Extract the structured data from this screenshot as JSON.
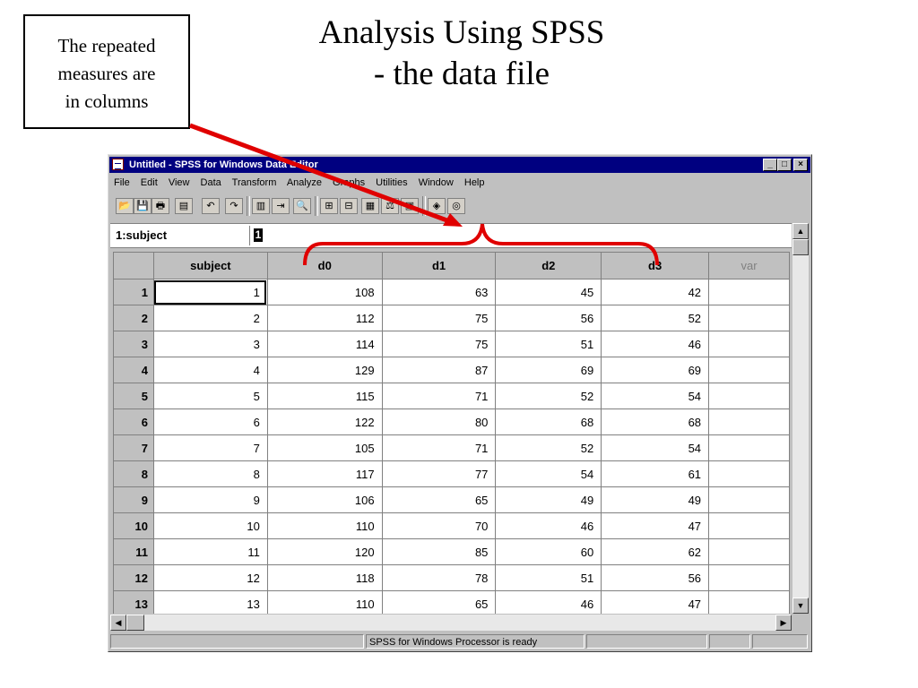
{
  "slide": {
    "title_line1": "Analysis Using SPSS",
    "title_line2": "- the data file",
    "callout": [
      "The repeated",
      "measures are",
      "in columns"
    ]
  },
  "window": {
    "title": "Untitled - SPSS for Windows Data Editor",
    "buttons": [
      "_",
      "□",
      "×"
    ]
  },
  "menu": [
    "File",
    "Edit",
    "View",
    "Data",
    "Transform",
    "Analyze",
    "Graphs",
    "Utilities",
    "Window",
    "Help"
  ],
  "toolbar": {
    "icons": [
      "open-icon",
      "save-icon",
      "print-icon",
      "dialog-recall-icon",
      "undo-icon",
      "redo-icon",
      "goto-chart-icon",
      "goto-case-icon",
      "variables-icon",
      "find-icon",
      "insert-case-icon",
      "insert-variable-icon",
      "split-file-icon",
      "weight-cases-icon",
      "select-cases-icon",
      "value-labels-icon",
      "use-sets-icon"
    ],
    "glyphs": [
      "📂",
      "💾",
      "🖶",
      "▤",
      "↶",
      "↷",
      "▥",
      "⇥",
      "?",
      "🔍",
      "⊞",
      "⊟",
      "▦",
      "⚖",
      "▣",
      "◈",
      "◎"
    ]
  },
  "cell_editor": {
    "reference": "1:subject",
    "value": "1"
  },
  "grid": {
    "columns": [
      "subject",
      "d0",
      "d1",
      "d2",
      "d3",
      "var"
    ],
    "rows": [
      [
        "1",
        "1",
        "108",
        "63",
        "45",
        "42"
      ],
      [
        "2",
        "2",
        "112",
        "75",
        "56",
        "52"
      ],
      [
        "3",
        "3",
        "114",
        "75",
        "51",
        "46"
      ],
      [
        "4",
        "4",
        "129",
        "87",
        "69",
        "69"
      ],
      [
        "5",
        "5",
        "115",
        "71",
        "52",
        "54"
      ],
      [
        "6",
        "6",
        "122",
        "80",
        "68",
        "68"
      ],
      [
        "7",
        "7",
        "105",
        "71",
        "52",
        "54"
      ],
      [
        "8",
        "8",
        "117",
        "77",
        "54",
        "61"
      ],
      [
        "9",
        "9",
        "106",
        "65",
        "49",
        "49"
      ],
      [
        "10",
        "10",
        "110",
        "70",
        "46",
        "47"
      ],
      [
        "11",
        "11",
        "120",
        "85",
        "60",
        "62"
      ],
      [
        "12",
        "12",
        "118",
        "78",
        "51",
        "56"
      ],
      [
        "13",
        "13",
        "110",
        "65",
        "46",
        "47"
      ]
    ]
  },
  "status": {
    "message": "SPSS for Windows Processor is ready"
  },
  "colors": {
    "annotation": "#e00000",
    "titlebar": "#000080"
  }
}
